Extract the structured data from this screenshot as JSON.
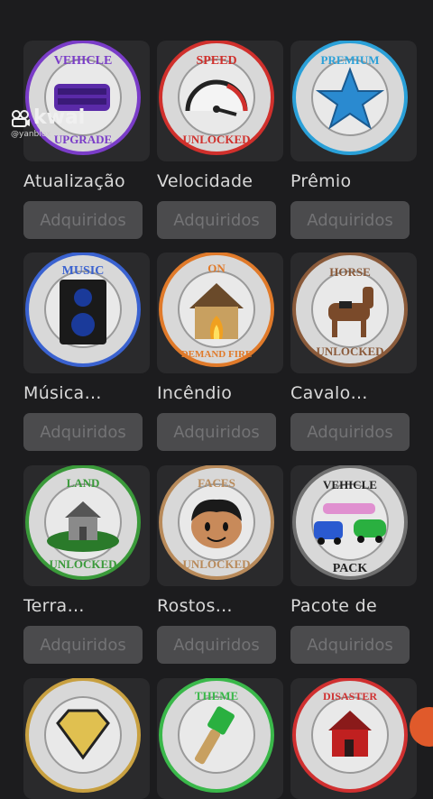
{
  "watermark": {
    "brand": "kwai",
    "user": "@yanblox"
  },
  "colors": {
    "background": "#1c1c1e",
    "button_bg": "#4b4b4d",
    "button_text": "#737375",
    "accent_fab": "#e05a2b"
  },
  "passes": [
    {
      "title": "Atualização",
      "button": "Adquiridos",
      "badge_top": "VEHICLE",
      "badge_bottom": "UPGRADE",
      "icon": "vehicle-upgrade-icon",
      "ring": "#7a3cc8"
    },
    {
      "title": "Velocidade",
      "button": "Adquiridos",
      "badge_top": "SPEED",
      "badge_bottom": "UNLOCKED",
      "icon": "speedometer-icon",
      "ring": "#d0302c"
    },
    {
      "title": "Prêmio",
      "button": "Adquiridos",
      "badge_top": "PREMIUM",
      "badge_bottom": "",
      "icon": "star-icon",
      "ring": "#2aa0d8"
    },
    {
      "title": "Música…",
      "button": "Adquiridos",
      "badge_top": "MUSIC",
      "badge_bottom": "",
      "icon": "speaker-icon",
      "ring": "#3a62d0"
    },
    {
      "title": "Incêndio",
      "button": "Adquiridos",
      "badge_top": "ON",
      "badge_bottom": "DEMAND FIRE",
      "icon": "burning-house-icon",
      "ring": "#e07a2a"
    },
    {
      "title": "Cavalo…",
      "button": "Adquiridos",
      "badge_top": "HORSE",
      "badge_bottom": "UNLOCKED",
      "icon": "horse-icon",
      "ring": "#8a5a3a"
    },
    {
      "title": "Terra…",
      "button": "Adquiridos",
      "badge_top": "LAND",
      "badge_bottom": "UNLOCKED",
      "icon": "land-house-icon",
      "ring": "#3a9a3a"
    },
    {
      "title": "Rostos…",
      "button": "Adquiridos",
      "badge_top": "FACES",
      "badge_bottom": "UNLOCKED",
      "icon": "face-icon",
      "ring": "#b88a5a"
    },
    {
      "title": "Pacote de",
      "button": "Adquiridos",
      "badge_top": "VEHICLE",
      "badge_bottom": "PACK",
      "icon": "vehicle-pack-icon",
      "ring": "#707070"
    },
    {
      "title": "",
      "button": "",
      "badge_top": "",
      "badge_bottom": "",
      "icon": "diamond-icon",
      "ring": "#c8a040"
    },
    {
      "title": "",
      "button": "",
      "badge_top": "THEME",
      "badge_bottom": "",
      "icon": "paintbrush-icon",
      "ring": "#3ab84a"
    },
    {
      "title": "",
      "button": "",
      "badge_top": "DISASTER",
      "badge_bottom": "",
      "icon": "disaster-house-icon",
      "ring": "#d03030"
    }
  ]
}
